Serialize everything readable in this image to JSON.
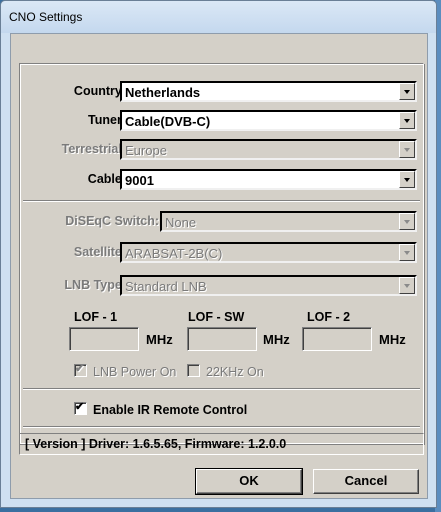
{
  "window": {
    "title": "CNO Settings"
  },
  "fields": {
    "country": {
      "label": "Country:",
      "value": "Netherlands"
    },
    "tuner": {
      "label": "Tuner:",
      "value": "Cable(DVB-C)"
    },
    "terrestrial": {
      "label": "Terrestrial:",
      "value": "Europe"
    },
    "cable": {
      "label": "Cable:",
      "value": "9001"
    },
    "diseqc": {
      "label": "DiSEqC Switch:",
      "value": "None"
    },
    "satellite": {
      "label": "Satellite:",
      "value": "ARABSAT-2B(C)"
    },
    "lnb_type": {
      "label": "LNB Type:",
      "value": "Standard LNB"
    }
  },
  "lof": {
    "lof1_label": "LOF - 1",
    "lofsw_label": "LOF - SW",
    "lof2_label": "LOF - 2",
    "unit": "MHz",
    "lof1_value": "",
    "lofsw_value": "",
    "lof2_value": ""
  },
  "options": {
    "lnb_power": {
      "label": "LNB Power On",
      "checked": true
    },
    "khz22": {
      "label": "22KHz On",
      "checked": false
    },
    "ir_remote": {
      "label": "Enable IR Remote Control",
      "checked": true
    }
  },
  "version": {
    "text": "[ Version ] Driver: 1.6.5.65,  Firmware: 1.2.0.0"
  },
  "buttons": {
    "ok": "OK",
    "cancel": "Cancel"
  },
  "icons": {
    "check": "✔"
  }
}
